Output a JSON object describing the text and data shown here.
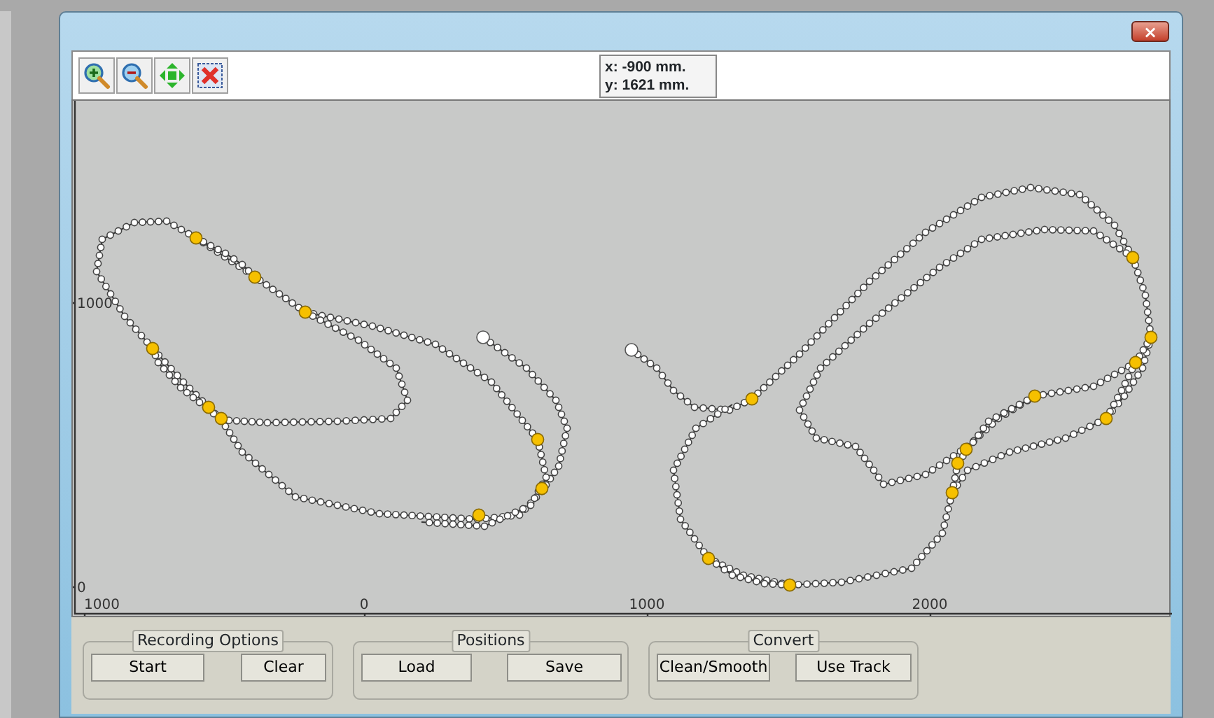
{
  "window": {
    "close_glyph": "×"
  },
  "toolbar": {
    "buttons": [
      {
        "kind": "zoom-in"
      },
      {
        "kind": "zoom-out"
      },
      {
        "kind": "fit"
      },
      {
        "kind": "clear"
      }
    ]
  },
  "cursor_readout": {
    "x": "x: -900 mm.",
    "y": "y: 1621 mm."
  },
  "plot": {
    "y_axis_labels": [
      "1000",
      "0"
    ],
    "x_axis_labels": [
      "1000",
      "0",
      "1000",
      "2000"
    ]
  },
  "groups": [
    {
      "title": "Recording Options",
      "buttons": [
        "Start",
        "Clear"
      ]
    },
    {
      "title": "Positions",
      "buttons": [
        "Load",
        "Save"
      ]
    },
    {
      "title": "Convert",
      "buttons": [
        "Clean/Smooth",
        "Use Track"
      ]
    }
  ]
}
